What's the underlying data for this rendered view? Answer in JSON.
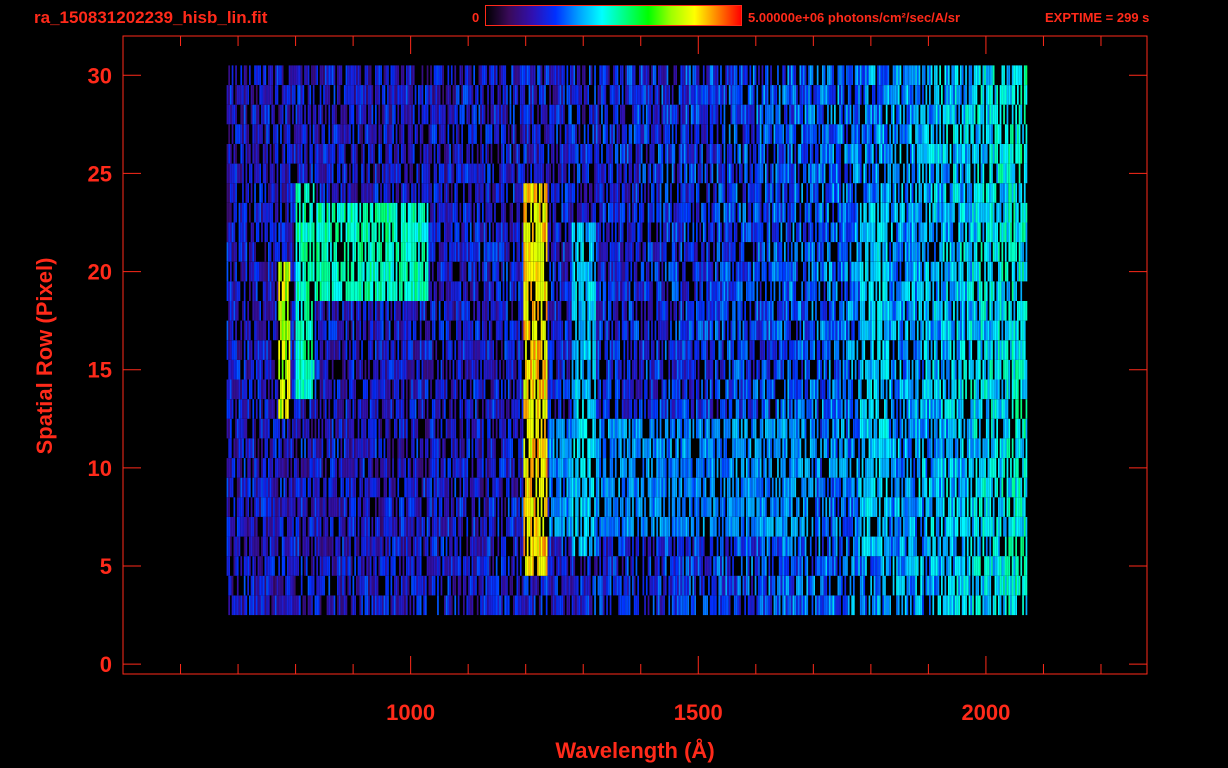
{
  "header": {
    "title": "ra_150831202239_hisb_lin.fit",
    "colorbar_min": "0",
    "colorbar_max": "5.00000e+06 photons/cm²/sec/A/sr",
    "exptime": "EXPTIME = 299 s"
  },
  "chart_data": {
    "type": "heatmap",
    "xlabel": "Wavelength (Å)",
    "ylabel": "Spatial Row (Pixel)",
    "xlim": [
      500,
      2280
    ],
    "ylim": [
      -0.5,
      32
    ],
    "xticks": [
      {
        "v": 1000,
        "label": "1000"
      },
      {
        "v": 1500,
        "label": "1500"
      },
      {
        "v": 2000,
        "label": "2000"
      }
    ],
    "yticks": [
      {
        "v": 0,
        "label": "0"
      },
      {
        "v": 5,
        "label": "5"
      },
      {
        "v": 10,
        "label": "10"
      },
      {
        "v": 15,
        "label": "15"
      },
      {
        "v": 20,
        "label": "20"
      },
      {
        "v": 25,
        "label": "25"
      },
      {
        "v": 30,
        "label": "30"
      }
    ],
    "colorbar": {
      "min": 0,
      "max": 5000000,
      "colormap": "rainbow"
    },
    "data_extent": {
      "wavelength": [
        680,
        2070
      ],
      "rows": [
        3,
        30
      ]
    },
    "features": [
      {
        "name": "arc",
        "wl": [
          770,
          790
        ],
        "rows": [
          13,
          20
        ],
        "level": 0.8
      },
      {
        "name": "arc2",
        "wl": [
          800,
          830
        ],
        "rows": [
          14,
          24
        ],
        "level": 0.55
      },
      {
        "name": "blob",
        "wl": [
          830,
          1030
        ],
        "rows": [
          19,
          23
        ],
        "level": 0.55
      },
      {
        "name": "Ly-alpha",
        "wl": [
          1195,
          1235
        ],
        "rows": [
          5,
          24
        ],
        "level": 0.85
      },
      {
        "name": "1304",
        "wl": [
          1280,
          1320
        ],
        "rows": [
          6,
          22
        ],
        "level": 0.45
      },
      {
        "name": "band",
        "wl": [
          1240,
          1700
        ],
        "rows": [
          7,
          12
        ],
        "level": 0.38
      },
      {
        "name": "1800",
        "wl": [
          1780,
          1830
        ],
        "rows": [
          6,
          23
        ],
        "level": 0.45
      }
    ]
  },
  "colors": {
    "axis": "#ff2a1a",
    "background": "#000000"
  }
}
